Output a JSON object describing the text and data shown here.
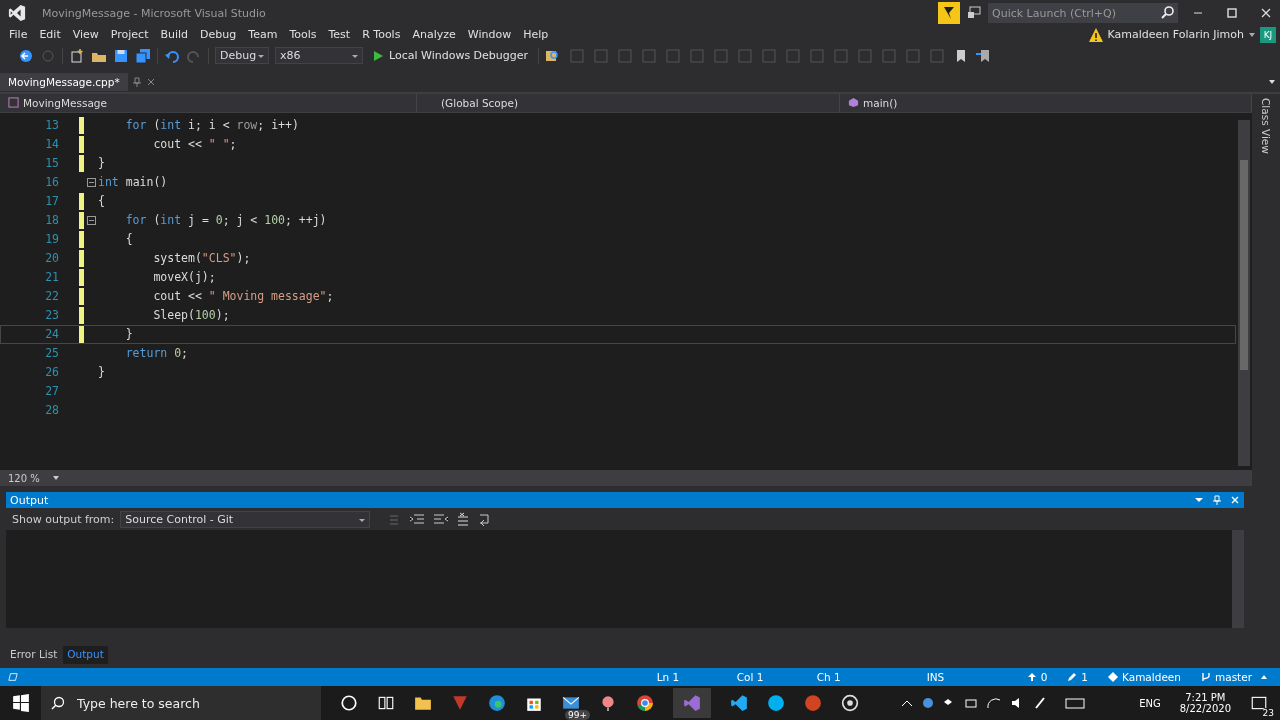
{
  "window": {
    "title": "MovingMessage - Microsoft Visual Studio",
    "quick_launch": {
      "placeholder": "Quick Launch (Ctrl+Q)"
    },
    "account": "Kamaldeen Folarin Jimoh",
    "avatar": "KJ"
  },
  "menu": [
    "File",
    "Edit",
    "View",
    "Project",
    "Build",
    "Debug",
    "Team",
    "Tools",
    "Test",
    "R Tools",
    "Analyze",
    "Window",
    "Help"
  ],
  "toolbar": {
    "configuration": "Debug",
    "platform": "x86",
    "run": "Local Windows Debugger"
  },
  "tabs": [
    {
      "label": "MovingMessage.cpp*",
      "selected": true
    }
  ],
  "nav_bar": {
    "project": "MovingMessage",
    "scope": "(Global Scope)",
    "member": "main()"
  },
  "side_tab": "Class View",
  "editor": {
    "zoom": "120 %",
    "lines": [
      {
        "number": "13",
        "changed": true,
        "fold": false,
        "current": false,
        "tokens": [
          {
            "kind": "kw",
            "text": "    for"
          },
          {
            "kind": "plain",
            "text": " ("
          },
          {
            "kind": "kw",
            "text": "int"
          },
          {
            "kind": "plain",
            "text": " i; i < "
          },
          {
            "kind": "dim",
            "text": "row"
          },
          {
            "kind": "plain",
            "text": "; i++)"
          }
        ]
      },
      {
        "number": "14",
        "changed": true,
        "fold": false,
        "current": false,
        "tokens": [
          {
            "kind": "plain",
            "text": "        cout << "
          },
          {
            "kind": "str",
            "text": "\" \""
          },
          {
            "kind": "plain",
            "text": ";"
          }
        ]
      },
      {
        "number": "15",
        "changed": true,
        "fold": false,
        "current": false,
        "tokens": [
          {
            "kind": "plain",
            "text": "}"
          }
        ]
      },
      {
        "number": "16",
        "changed": false,
        "fold": true,
        "current": false,
        "tokens": [
          {
            "kind": "kw",
            "text": "int"
          },
          {
            "kind": "plain",
            "text": " main()"
          }
        ]
      },
      {
        "number": "17",
        "changed": true,
        "fold": false,
        "current": false,
        "tokens": [
          {
            "kind": "plain",
            "text": "{"
          }
        ]
      },
      {
        "number": "18",
        "changed": true,
        "fold": true,
        "current": false,
        "tokens": [
          {
            "kind": "kw",
            "text": "    for"
          },
          {
            "kind": "plain",
            "text": " ("
          },
          {
            "kind": "kw",
            "text": "int"
          },
          {
            "kind": "plain",
            "text": " j = "
          },
          {
            "kind": "num",
            "text": "0"
          },
          {
            "kind": "plain",
            "text": "; j < "
          },
          {
            "kind": "num",
            "text": "100"
          },
          {
            "kind": "plain",
            "text": "; ++j)"
          }
        ]
      },
      {
        "number": "19",
        "changed": true,
        "fold": false,
        "current": false,
        "tokens": [
          {
            "kind": "plain",
            "text": "    {"
          }
        ]
      },
      {
        "number": "20",
        "changed": true,
        "fold": false,
        "current": false,
        "tokens": [
          {
            "kind": "plain",
            "text": "        system("
          },
          {
            "kind": "str",
            "text": "\"CLS\""
          },
          {
            "kind": "plain",
            "text": ");"
          }
        ]
      },
      {
        "number": "21",
        "changed": true,
        "fold": false,
        "current": false,
        "tokens": [
          {
            "kind": "plain",
            "text": "        moveX(j);"
          }
        ]
      },
      {
        "number": "22",
        "changed": true,
        "fold": false,
        "current": false,
        "tokens": [
          {
            "kind": "plain",
            "text": "        cout << "
          },
          {
            "kind": "str",
            "text": "\" Moving message\""
          },
          {
            "kind": "plain",
            "text": ";"
          }
        ]
      },
      {
        "number": "23",
        "changed": true,
        "fold": false,
        "current": false,
        "tokens": [
          {
            "kind": "plain",
            "text": "        Sleep("
          },
          {
            "kind": "num",
            "text": "100"
          },
          {
            "kind": "plain",
            "text": ");"
          }
        ]
      },
      {
        "number": "24",
        "changed": true,
        "fold": false,
        "current": true,
        "tokens": [
          {
            "kind": "plain",
            "text": "    }"
          }
        ]
      },
      {
        "number": "25",
        "changed": false,
        "fold": false,
        "current": false,
        "tokens": [
          {
            "kind": "kw",
            "text": "    return"
          },
          {
            "kind": "num",
            "text": " 0"
          },
          {
            "kind": "plain",
            "text": ";"
          }
        ]
      },
      {
        "number": "26",
        "changed": false,
        "fold": false,
        "current": false,
        "tokens": [
          {
            "kind": "plain",
            "text": "}"
          }
        ]
      },
      {
        "number": "27",
        "changed": false,
        "fold": false,
        "current": false
      },
      {
        "number": "28",
        "changed": false,
        "fold": false,
        "current": false
      }
    ]
  },
  "output": {
    "title": "Output",
    "show_from_label": "Show output from:",
    "source": "Source Control - Git"
  },
  "bottom_tabs": [
    {
      "label": "Error List",
      "selected": false
    },
    {
      "label": "Output",
      "selected": true
    }
  ],
  "status_bar": {
    "line": "Ln 1",
    "column": "Col 1",
    "char": "Ch 1",
    "mode": "INS",
    "pushes": "0",
    "changes": "1",
    "repo_user": "Kamaldeen",
    "branch": "master"
  },
  "taskbar": {
    "search_placeholder": "Type here to search",
    "mail_badge": "99+",
    "time": "7:21 PM",
    "date": "8/22/2020",
    "notifications": "23",
    "language": "ENG"
  }
}
